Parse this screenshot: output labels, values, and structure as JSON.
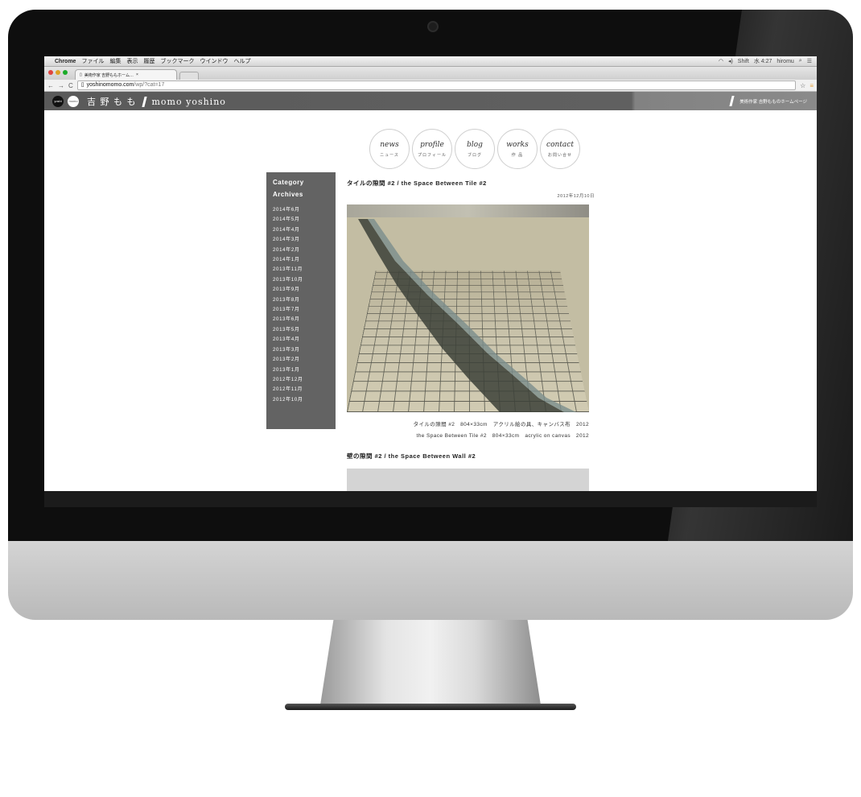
{
  "mac_menubar": {
    "app": "Chrome",
    "menus": [
      "ファイル",
      "編集",
      "表示",
      "履歴",
      "ブックマーク",
      "ウインドウ",
      "ヘルプ"
    ],
    "status": [
      "Shift",
      "水 4:27",
      "hiromu"
    ]
  },
  "browser": {
    "tab_title": "美術作家 吉野ももホーム…",
    "url_host": "yoshinomomo.com",
    "url_path": "/wp/?cat=17"
  },
  "site": {
    "logo_dark": "yoshi",
    "logo_light": "momo",
    "name_ja": "吉 野 も も",
    "name_en": "momo yoshino",
    "header_tagline": "美術作家 吉野もものホームページ"
  },
  "nav": [
    {
      "en": "news",
      "ja": "ニュース"
    },
    {
      "en": "profile",
      "ja": "プロフィール"
    },
    {
      "en": "blog",
      "ja": "ブログ"
    },
    {
      "en": "works",
      "ja": "作 品"
    },
    {
      "en": "contact",
      "ja": "お問い合せ"
    }
  ],
  "sidebar": {
    "category_label": "Category",
    "archives_label": "Archives",
    "archives": [
      "2014年6月",
      "2014年5月",
      "2014年4月",
      "2014年3月",
      "2014年2月",
      "2014年1月",
      "2013年11月",
      "2013年10月",
      "2013年9月",
      "2013年8月",
      "2013年7月",
      "2013年6月",
      "2013年5月",
      "2013年4月",
      "2013年3月",
      "2013年2月",
      "2013年1月",
      "2012年12月",
      "2012年11月",
      "2012年10月"
    ]
  },
  "posts": [
    {
      "title": "タイルの隙間 #2 / the Space Between Tile #2",
      "date": "2012年12月10日",
      "caption_ja": "タイルの隙間 #2　804×33cm　アクリル絵の具、キャンバス布　2012",
      "caption_en": "the Space Between Tile #2　804×33cm　acrylic on canvas　2012"
    },
    {
      "title": "壁の隙間 #2 / the Space Between Wall #2"
    }
  ],
  "colors": {
    "header_bg": "#5a5a5a",
    "sidebar_bg": "#636363"
  }
}
